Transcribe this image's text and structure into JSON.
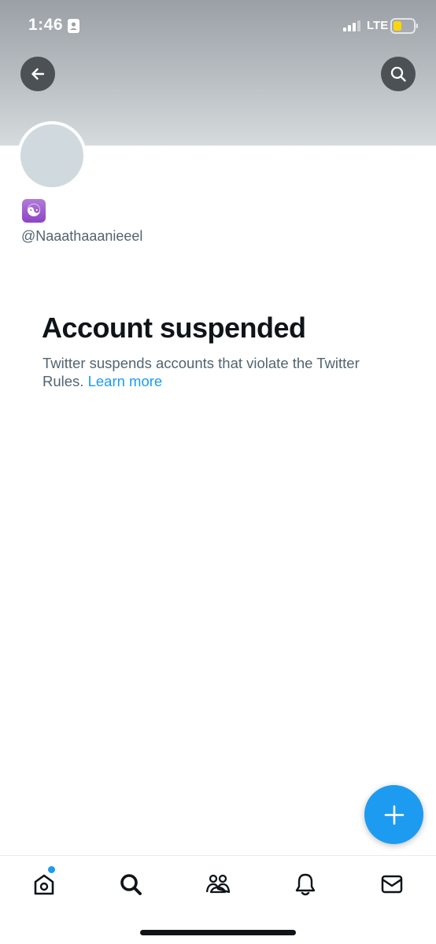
{
  "status_bar": {
    "time": "1:46",
    "network": "LTE",
    "icons": [
      "contact-card-icon",
      "signal-icon",
      "battery-icon"
    ]
  },
  "header": {
    "back_icon": "arrow-left-icon",
    "search_icon": "search-icon"
  },
  "profile": {
    "display_name_emoji": "☯",
    "handle": "@Naaathaaanieeel"
  },
  "suspension": {
    "title": "Account suspended",
    "message": "Twitter suspends accounts that violate the Twitter Rules.",
    "link_text": "Learn more"
  },
  "fab": {
    "icon": "plus-icon"
  },
  "tabs": [
    {
      "name": "home",
      "icon": "home-icon"
    },
    {
      "name": "search",
      "icon": "search-icon"
    },
    {
      "name": "communities",
      "icon": "communities-icon"
    },
    {
      "name": "notifications",
      "icon": "bell-icon"
    },
    {
      "name": "messages",
      "icon": "mail-icon"
    }
  ],
  "colors": {
    "accent": "#1d9bf0",
    "text_primary": "#0f1419",
    "text_secondary": "#536471",
    "avatar_placeholder": "#cfd9de"
  }
}
